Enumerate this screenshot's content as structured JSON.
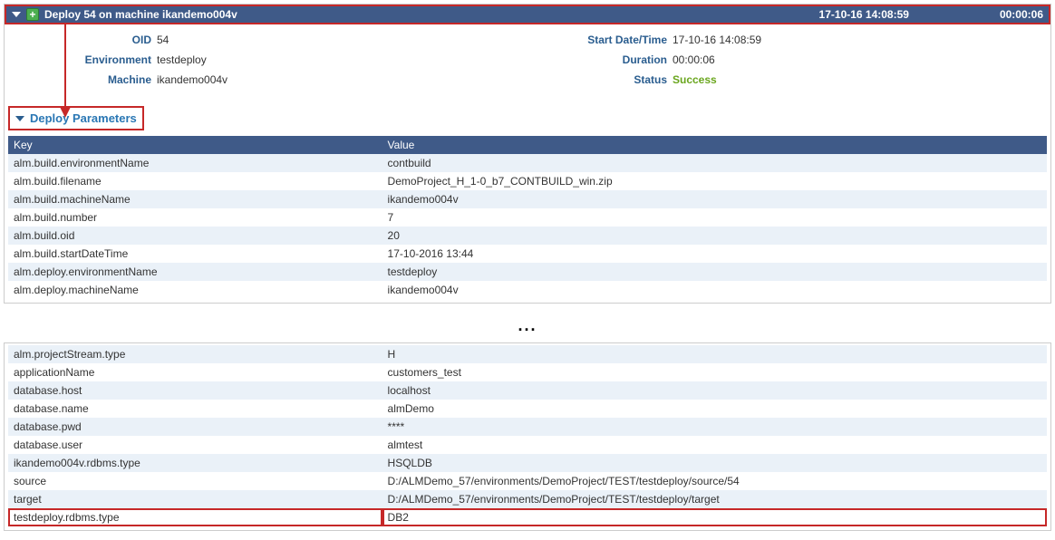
{
  "header": {
    "title": "Deploy 54 on machine ikandemo004v",
    "datetime": "17-10-16 14:08:59",
    "duration": "00:00:06"
  },
  "details": {
    "oid_label": "OID",
    "oid_value": "54",
    "start_label": "Start Date/Time",
    "start_value": "17-10-16 14:08:59",
    "env_label": "Environment",
    "env_value": "testdeploy",
    "dur_label": "Duration",
    "dur_value": "00:00:06",
    "machine_label": "Machine",
    "machine_value": "ikandemo004v",
    "status_label": "Status",
    "status_value": "Success"
  },
  "section_title": "Deploy Parameters",
  "table": {
    "col_key": "Key",
    "col_val": "Value",
    "rows1": [
      {
        "k": "alm.build.environmentName",
        "v": "contbuild"
      },
      {
        "k": "alm.build.filename",
        "v": "DemoProject_H_1-0_b7_CONTBUILD_win.zip"
      },
      {
        "k": "alm.build.machineName",
        "v": "ikandemo004v"
      },
      {
        "k": "alm.build.number",
        "v": "7"
      },
      {
        "k": "alm.build.oid",
        "v": "20"
      },
      {
        "k": "alm.build.startDateTime",
        "v": "17-10-2016 13:44"
      },
      {
        "k": "alm.deploy.environmentName",
        "v": "testdeploy"
      },
      {
        "k": "alm.deploy.machineName",
        "v": "ikandemo004v"
      }
    ],
    "rows2": [
      {
        "k": "alm.projectStream.type",
        "v": "H"
      },
      {
        "k": "applicationName",
        "v": "customers_test"
      },
      {
        "k": "database.host",
        "v": "localhost"
      },
      {
        "k": "database.name",
        "v": "almDemo"
      },
      {
        "k": "database.pwd",
        "v": "****"
      },
      {
        "k": "database.user",
        "v": "almtest"
      },
      {
        "k": "ikandemo004v.rdbms.type",
        "v": "HSQLDB"
      },
      {
        "k": "source",
        "v": "D:/ALMDemo_57/environments/DemoProject/TEST/testdeploy/source/54"
      },
      {
        "k": "target",
        "v": "D:/ALMDemo_57/environments/DemoProject/TEST/testdeploy/target"
      },
      {
        "k": "testdeploy.rdbms.type",
        "v": "DB2"
      }
    ],
    "highlight_key": "testdeploy.rdbms.type"
  },
  "ellipsis": "..."
}
